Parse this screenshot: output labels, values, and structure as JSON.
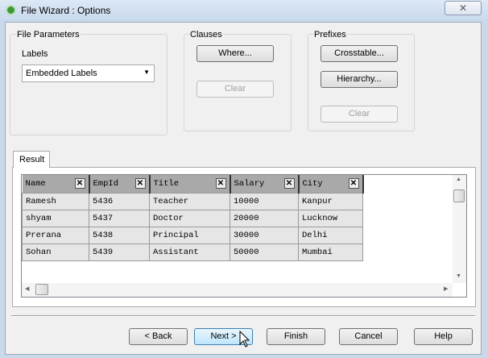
{
  "window": {
    "title": "File Wizard : Options",
    "close_glyph": "✕"
  },
  "file_parameters": {
    "title": "File Parameters",
    "labels_label": "Labels",
    "labels_value": "Embedded Labels"
  },
  "clauses": {
    "title": "Clauses",
    "where": "Where...",
    "clear": "Clear"
  },
  "prefixes": {
    "title": "Prefixes",
    "crosstable": "Crosstable...",
    "hierarchy": "Hierarchy...",
    "clear": "Clear"
  },
  "result": {
    "tab": "Result",
    "columns": [
      "Name",
      "EmpId",
      "Title",
      "Salary",
      "City"
    ],
    "rows": [
      [
        "Ramesh",
        "5436",
        "Teacher",
        "10000",
        "Kanpur"
      ],
      [
        "shyam",
        "5437",
        "Doctor",
        "20000",
        "Lucknow"
      ],
      [
        "Prerana",
        "5438",
        "Principal",
        "30000",
        "Delhi"
      ],
      [
        "Sohan",
        "5439",
        "Assistant",
        "50000",
        "Mumbai"
      ]
    ]
  },
  "footer": {
    "back": "< Back",
    "next": "Next >",
    "finish": "Finish",
    "cancel": "Cancel",
    "help": "Help"
  }
}
